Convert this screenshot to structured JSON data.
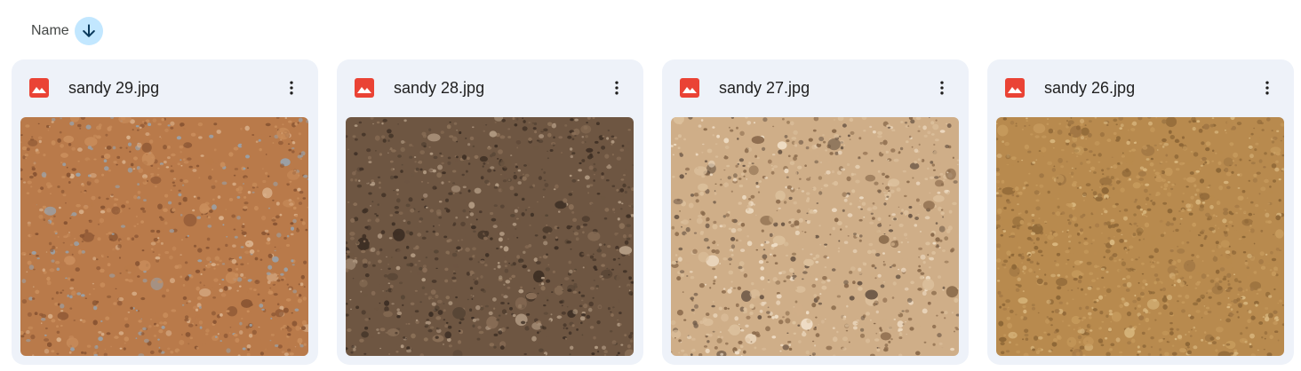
{
  "sort": {
    "label": "Name",
    "direction_icon": "arrow-down-icon"
  },
  "files": [
    {
      "name": "sandy 29.jpg",
      "type_icon": "image-file-icon",
      "colors": {
        "base": "#b97a4a",
        "mid": "#c98d5b",
        "dark": "#8a5533",
        "light": "#d9b08a",
        "accent": "#9aa0a6"
      }
    },
    {
      "name": "sandy 28.jpg",
      "type_icon": "image-file-icon",
      "colors": {
        "base": "#6e5642",
        "mid": "#8a6f57",
        "dark": "#3f3025",
        "light": "#b19a82",
        "accent": "#574535"
      }
    },
    {
      "name": "sandy 27.jpg",
      "type_icon": "image-file-icon",
      "colors": {
        "base": "#cfae88",
        "mid": "#dcc09c",
        "dark": "#8b6b4c",
        "light": "#eedcc4",
        "accent": "#6f5a48"
      }
    },
    {
      "name": "sandy 26.jpg",
      "type_icon": "image-file-icon",
      "colors": {
        "base": "#b88a4e",
        "mid": "#c69a5c",
        "dark": "#8e6737",
        "light": "#d8b67d",
        "accent": "#a17744"
      }
    }
  ],
  "colors": {
    "card_bg": "#eef2f9",
    "sort_accent": "#c2e7ff",
    "image_icon": "#ea4335"
  }
}
